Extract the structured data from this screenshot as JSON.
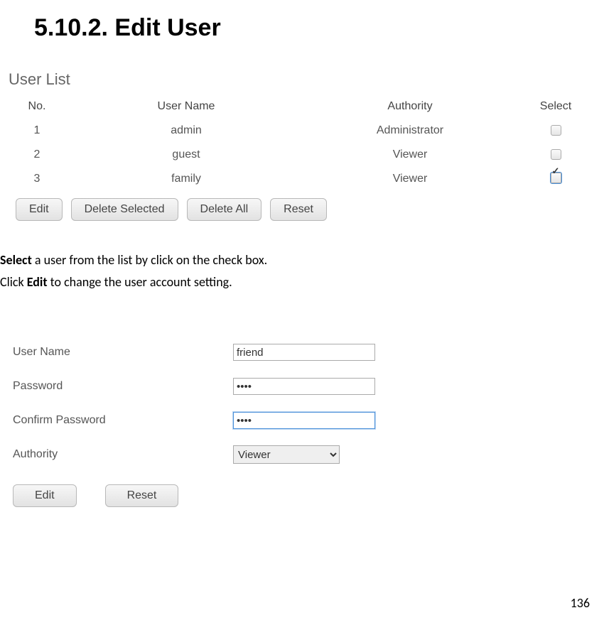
{
  "heading": "5.10.2. Edit User",
  "user_list": {
    "title": "User List",
    "columns": {
      "no": "No.",
      "name": "User Name",
      "auth": "Authority",
      "select": "Select"
    },
    "rows": [
      {
        "no": "1",
        "name": "admin",
        "auth": "Administrator",
        "checked": false
      },
      {
        "no": "2",
        "name": "guest",
        "auth": "Viewer",
        "checked": false
      },
      {
        "no": "3",
        "name": "family",
        "auth": "Viewer",
        "checked": true
      }
    ],
    "buttons": {
      "edit": "Edit",
      "delete_selected": "Delete Selected",
      "delete_all": "Delete All",
      "reset": "Reset"
    }
  },
  "instructions": {
    "line1_bold": "Select",
    "line1_rest": " a user from the list by click on the check box.",
    "line2_pre": "Click ",
    "line2_bold": "Edit",
    "line2_rest": " to change the user account setting."
  },
  "edit_form": {
    "labels": {
      "username": "User Name",
      "password": "Password",
      "confirm": "Confirm Password",
      "authority": "Authority"
    },
    "values": {
      "username": "friend",
      "password": "••••",
      "confirm": "••••",
      "authority": "Viewer"
    },
    "buttons": {
      "edit": "Edit",
      "reset": "Reset"
    }
  },
  "page_number": "136"
}
